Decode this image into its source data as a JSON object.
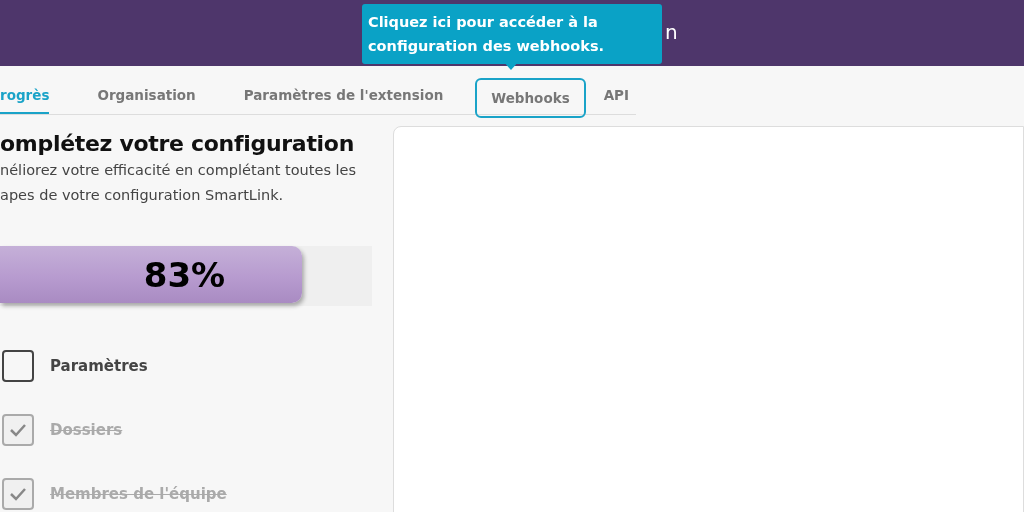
{
  "header": {
    "title": "n"
  },
  "tooltip": {
    "text": "Cliquez ici pour accéder à la configuration des webhooks."
  },
  "tabs": [
    {
      "label": "rogrès",
      "selected": true,
      "highlighted": false
    },
    {
      "label": "Organisation",
      "selected": false,
      "highlighted": false
    },
    {
      "label": "Paramètres de l'extension",
      "selected": false,
      "highlighted": false
    },
    {
      "label": "Webhooks",
      "selected": false,
      "highlighted": true
    },
    {
      "label": "API",
      "selected": false,
      "highlighted": false
    }
  ],
  "progress": {
    "title": "omplétez votre configuration",
    "description": [
      "néliorez votre efficacité en complétant toutes les",
      "apes de votre configuration SmartLink."
    ],
    "level": 0.83,
    "reading": "83%"
  },
  "steps": [
    {
      "label": "Paramètres",
      "checked": false
    },
    {
      "label": "Dossiers",
      "checked": true
    },
    {
      "label": "Membres de l'équipe",
      "checked": true
    }
  ]
}
